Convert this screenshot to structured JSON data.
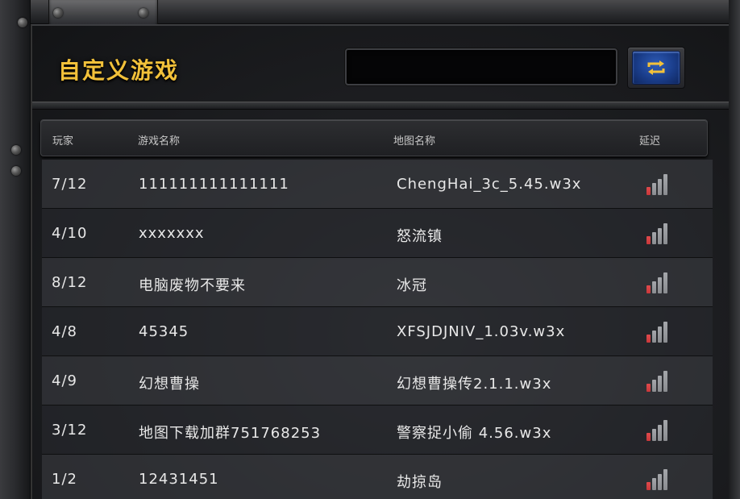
{
  "title": "自定义游戏",
  "search": {
    "value": "",
    "placeholder": ""
  },
  "refresh_icon": "refresh-arrows-icon",
  "columns": {
    "players": "玩家",
    "game_name": "游戏名称",
    "map_name": "地图名称",
    "latency": "延迟"
  },
  "colors": {
    "title": "#f2c13a",
    "latency_good": "#c8373a",
    "latency_idle": "#8a8c90",
    "refresh_blue": "#1a3d8a"
  },
  "rows": [
    {
      "players": "7/12",
      "game": "111111111111111",
      "map": "ChengHai_3c_5.45.w3x",
      "latency_bars": 1
    },
    {
      "players": "4/10",
      "game": "xxxxxxx",
      "map": "怒流镇",
      "latency_bars": 1
    },
    {
      "players": "8/12",
      "game": "电脑废物不要来",
      "map": "冰冠",
      "latency_bars": 1
    },
    {
      "players": "4/8",
      "game": "45345",
      "map": "XFSJDJNIV_1.03v.w3x",
      "latency_bars": 1
    },
    {
      "players": "4/9",
      "game": "幻想曹操",
      "map": "幻想曹操传2.1.1.w3x",
      "latency_bars": 1
    },
    {
      "players": "3/12",
      "game": "地图下载加群751768253",
      "map": "警察捉小偷 4.56.w3x",
      "latency_bars": 1
    },
    {
      "players": "1/2",
      "game": "12431451",
      "map": "劫掠岛",
      "latency_bars": 1
    }
  ]
}
